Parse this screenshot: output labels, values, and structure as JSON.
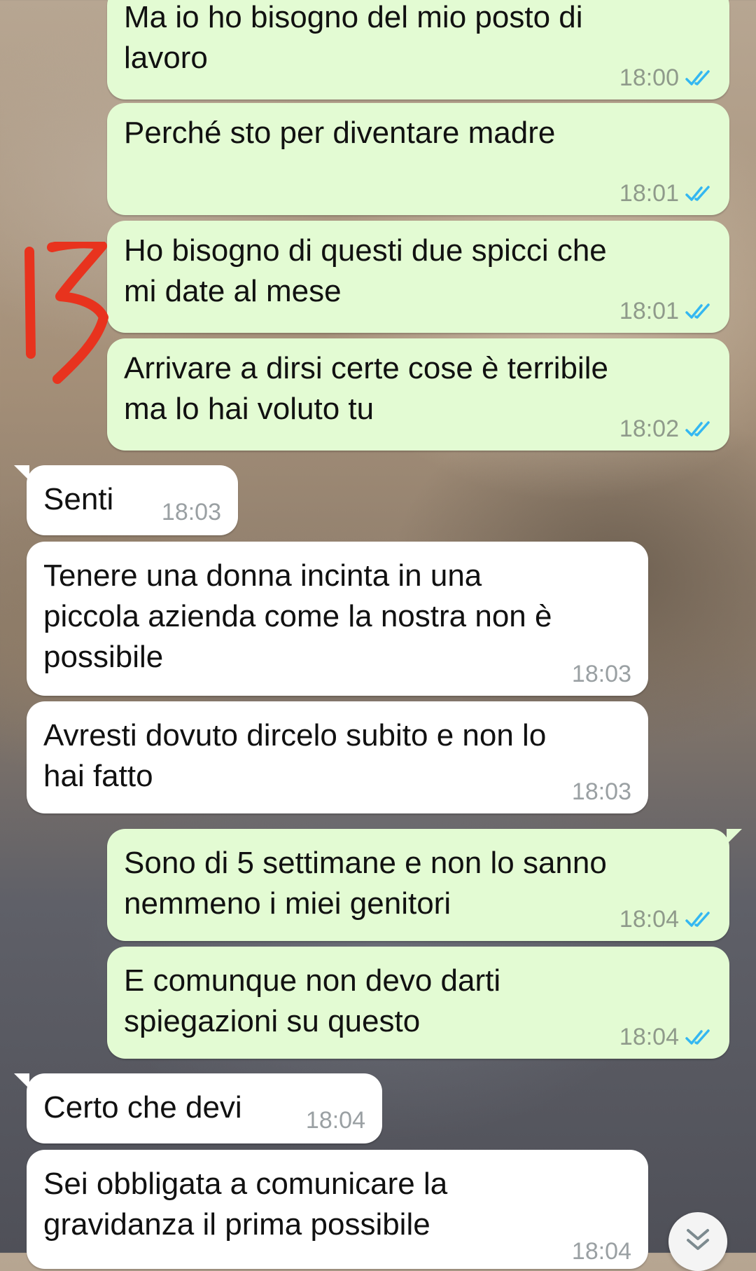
{
  "chat": {
    "messages": [
      {
        "direction": "outgoing",
        "text": "Ma io ho bisogno del mio posto di\nlavoro",
        "time": "18:00",
        "status": "read-double-check"
      },
      {
        "direction": "outgoing",
        "text": "Perché sto per diventare madre",
        "time": "18:01",
        "status": "read-double-check"
      },
      {
        "direction": "outgoing",
        "text": "Ho bisogno di questi due spicci che\nmi date al mese",
        "time": "18:01",
        "status": "read-double-check"
      },
      {
        "direction": "outgoing",
        "text": "Arrivare a dirsi certe cose è terribile\nma lo hai voluto tu",
        "time": "18:02",
        "status": "read-double-check"
      },
      {
        "direction": "incoming",
        "text": "Senti",
        "time": "18:03"
      },
      {
        "direction": "incoming",
        "text": "Tenere una donna incinta in una\npiccola azienda come la nostra non è\npossibile",
        "time": "18:03"
      },
      {
        "direction": "incoming",
        "text": "Avresti dovuto dircelo subito e non lo\nhai fatto",
        "time": "18:03"
      },
      {
        "direction": "outgoing",
        "text": "Sono di 5 settimane e non lo sanno\nnemmeno i miei genitori",
        "time": "18:04",
        "status": "read-double-check"
      },
      {
        "direction": "outgoing",
        "text": "E comunque non devo darti\nspiegazioni su questo",
        "time": "18:04",
        "status": "read-double-check"
      },
      {
        "direction": "incoming",
        "text": "Certo che devi",
        "time": "18:04"
      },
      {
        "direction": "incoming",
        "text": "Sei obbligata a comunicare la\ngravidanza il prima possibile",
        "time": "18:04"
      }
    ]
  },
  "annotation": {
    "icon": "handwritten-number-mark",
    "color": "#e8331e"
  },
  "scroll_button": {
    "icon": "double-chevron-down-icon"
  },
  "colors": {
    "outgoing_bubble": "#e3fbd3",
    "incoming_bubble": "#ffffff",
    "read_check": "#34b7f1"
  }
}
